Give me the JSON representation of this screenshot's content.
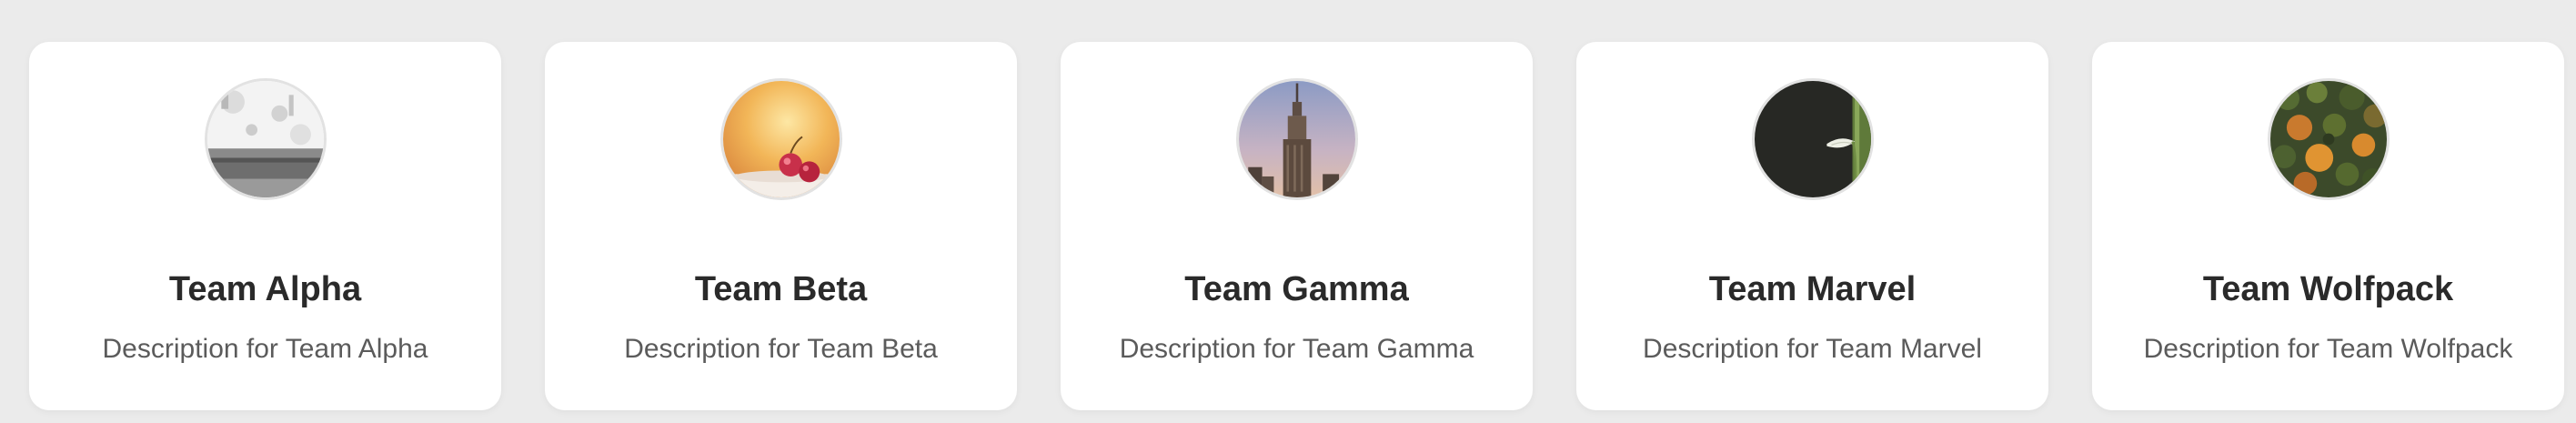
{
  "teams": [
    {
      "name": "Team Alpha",
      "description": "Description for Team Alpha",
      "avatar": "concrete-wall-photo"
    },
    {
      "name": "Team Beta",
      "description": "Description for Team Beta",
      "avatar": "cherries-sunset-photo"
    },
    {
      "name": "Team Gamma",
      "description": "Description for Team Gamma",
      "avatar": "skyscraper-photo"
    },
    {
      "name": "Team Marvel",
      "description": "Description for Team Marvel",
      "avatar": "dark-flower-photo"
    },
    {
      "name": "Team Wolfpack",
      "description": "Description for Team Wolfpack",
      "avatar": "forest-aerial-photo"
    }
  ],
  "colors": {
    "background": "#ebebeb",
    "card": "#ffffff",
    "title": "#2a2a2a",
    "description": "#5b5b5b"
  }
}
